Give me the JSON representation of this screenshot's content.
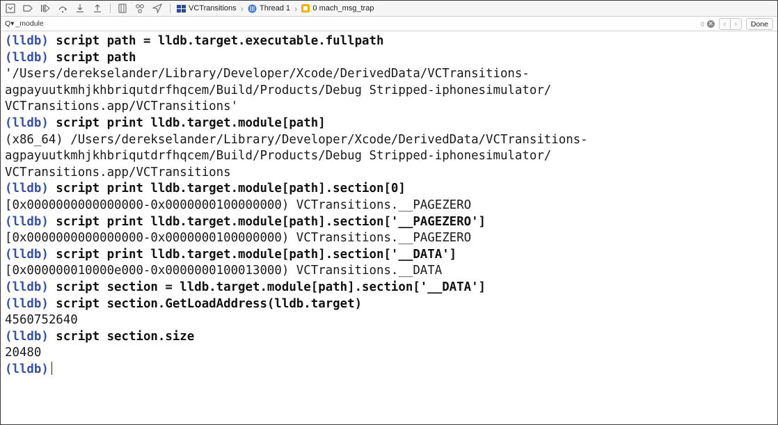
{
  "toolbar": {
    "breadcrumbs": [
      {
        "label": "VCTransitions"
      },
      {
        "label": "Thread 1"
      },
      {
        "label": "0 mach_msg_trap"
      }
    ]
  },
  "filter": {
    "prefix": "Q▾",
    "value": "_module",
    "count": "0",
    "done_label": "Done"
  },
  "console": {
    "prompt": "(lldb)",
    "lines": [
      {
        "type": "cmd",
        "text": "script path = lldb.target.executable.fullpath"
      },
      {
        "type": "cmd",
        "text": "script path"
      },
      {
        "type": "out",
        "text": "'/Users/derekselander/Library/Developer/Xcode/DerivedData/VCTransitions-"
      },
      {
        "type": "out",
        "text": "agpayuutkmhjkhbriqutdrfhqcem/Build/Products/Debug Stripped-iphonesimulator/"
      },
      {
        "type": "out",
        "text": "VCTransitions.app/VCTransitions'"
      },
      {
        "type": "cmd",
        "text": "script print lldb.target.module[path]"
      },
      {
        "type": "out",
        "text": "(x86_64) /Users/derekselander/Library/Developer/Xcode/DerivedData/VCTransitions-"
      },
      {
        "type": "out",
        "text": "agpayuutkmhjkhbriqutdrfhqcem/Build/Products/Debug Stripped-iphonesimulator/"
      },
      {
        "type": "out",
        "text": "VCTransitions.app/VCTransitions"
      },
      {
        "type": "cmd",
        "text": "script print lldb.target.module[path].section[0]"
      },
      {
        "type": "out",
        "text": "[0x0000000000000000-0x0000000100000000) VCTransitions.__PAGEZERO"
      },
      {
        "type": "cmd",
        "text": "script print lldb.target.module[path].section['__PAGEZERO']"
      },
      {
        "type": "out",
        "text": "[0x0000000000000000-0x0000000100000000) VCTransitions.__PAGEZERO"
      },
      {
        "type": "cmd",
        "text": "script print lldb.target.module[path].section['__DATA']"
      },
      {
        "type": "out",
        "text": "[0x000000010000e000-0x0000000100013000) VCTransitions.__DATA"
      },
      {
        "type": "cmd",
        "text": "script section = lldb.target.module[path].section['__DATA']"
      },
      {
        "type": "cmd",
        "text": "script section.GetLoadAddress(lldb.target)"
      },
      {
        "type": "out",
        "text": "4560752640"
      },
      {
        "type": "cmd",
        "text": "script section.size"
      },
      {
        "type": "out",
        "text": "20480"
      },
      {
        "type": "prompt-only",
        "text": ""
      }
    ]
  },
  "colors": {
    "prompt": "#3550a8",
    "breadcrumb_frame_icon": "#f2b300",
    "thread_icon": "#3a7bd5"
  },
  "icons": [
    "console-toggle-icon",
    "breakpoints-toggle-icon",
    "continue-icon",
    "step-over-icon",
    "step-into-icon",
    "step-out-icon",
    "view-hierarchy-icon",
    "memory-graph-icon",
    "location-icon",
    "app-icon",
    "thread-icon",
    "stack-frame-icon",
    "search-icon",
    "clear-icon",
    "previous-icon",
    "next-icon"
  ]
}
